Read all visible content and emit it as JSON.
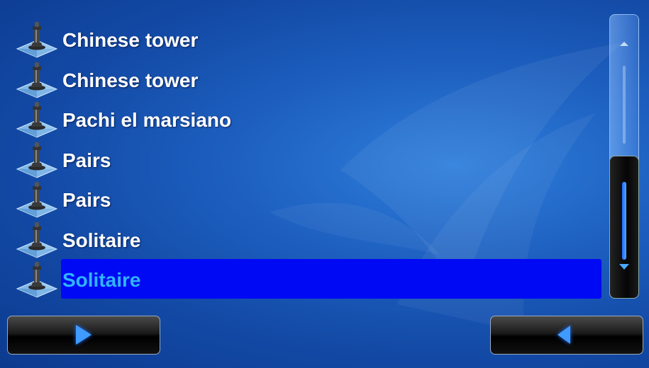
{
  "games": [
    {
      "label": "Chinese tower",
      "selected": false
    },
    {
      "label": "Chinese tower",
      "selected": false
    },
    {
      "label": "Pachi el marsiano",
      "selected": false
    },
    {
      "label": "Pairs",
      "selected": false
    },
    {
      "label": "Pairs",
      "selected": false
    },
    {
      "label": "Solitaire",
      "selected": false
    },
    {
      "label": "Solitaire",
      "selected": true
    }
  ],
  "icons": {
    "item": "chess-pawn-on-tile-icon",
    "forward": "play-right-arrow-icon",
    "back": "back-left-arrow-icon",
    "scroll_up": "scroll-up-arrow-icon",
    "scroll_down": "scroll-down-arrow-icon"
  },
  "colors": {
    "background": "#1d5fbf",
    "selection": "#0009f4",
    "selected_text": "#2fb4ff",
    "text": "#ffffff",
    "accent": "#3f9bff"
  },
  "scroll": {
    "position": 0.95
  }
}
